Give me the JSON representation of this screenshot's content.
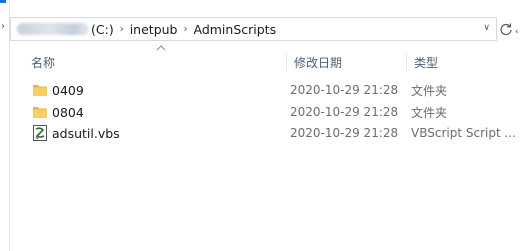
{
  "address_bar": {
    "drive_label": "(C:)",
    "path": [
      "inetpub",
      "AdminScripts"
    ]
  },
  "columns": {
    "name": "名称",
    "date": "修改日期",
    "type": "类型"
  },
  "files": [
    {
      "name": "0409",
      "date": "2020-10-29 21:28",
      "type": "文件夹",
      "icon": "folder-icon"
    },
    {
      "name": "0804",
      "date": "2020-10-29 21:28",
      "type": "文件夹",
      "icon": "folder-icon"
    },
    {
      "name": "adsutil.vbs",
      "date": "2020-10-29 21:28",
      "type": "VBScript Script ...",
      "icon": "vbscript-file-icon"
    }
  ],
  "colors": {
    "header_text": "#4c607a",
    "folder": "#f4cf62",
    "accent": "#1f6fd1"
  }
}
